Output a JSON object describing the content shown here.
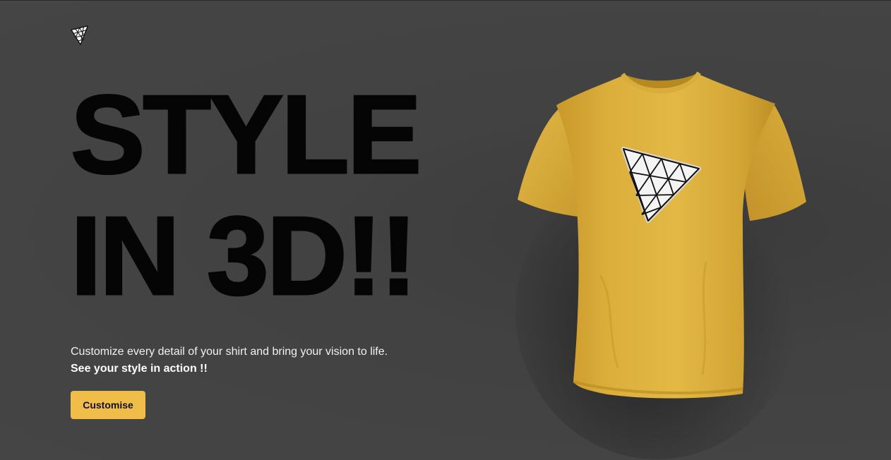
{
  "header": {
    "logo_icon": "threejs-triangle-logo-icon"
  },
  "hero": {
    "headline_line1": "STYLE",
    "headline_line2": "IN 3D!!",
    "description_text": "Customize every detail of your shirt and bring your vision to life.",
    "description_emphasis": "See your style in action !!",
    "cta_label": "Customise"
  },
  "model": {
    "item": "t-shirt",
    "shirt_color": "#e0b33f",
    "decal_icon": "threejs-triangle-logo-icon"
  },
  "colors": {
    "background": "#444444",
    "headline": "#050505",
    "accent": "#efbd48",
    "text": "#f1f1f1"
  }
}
